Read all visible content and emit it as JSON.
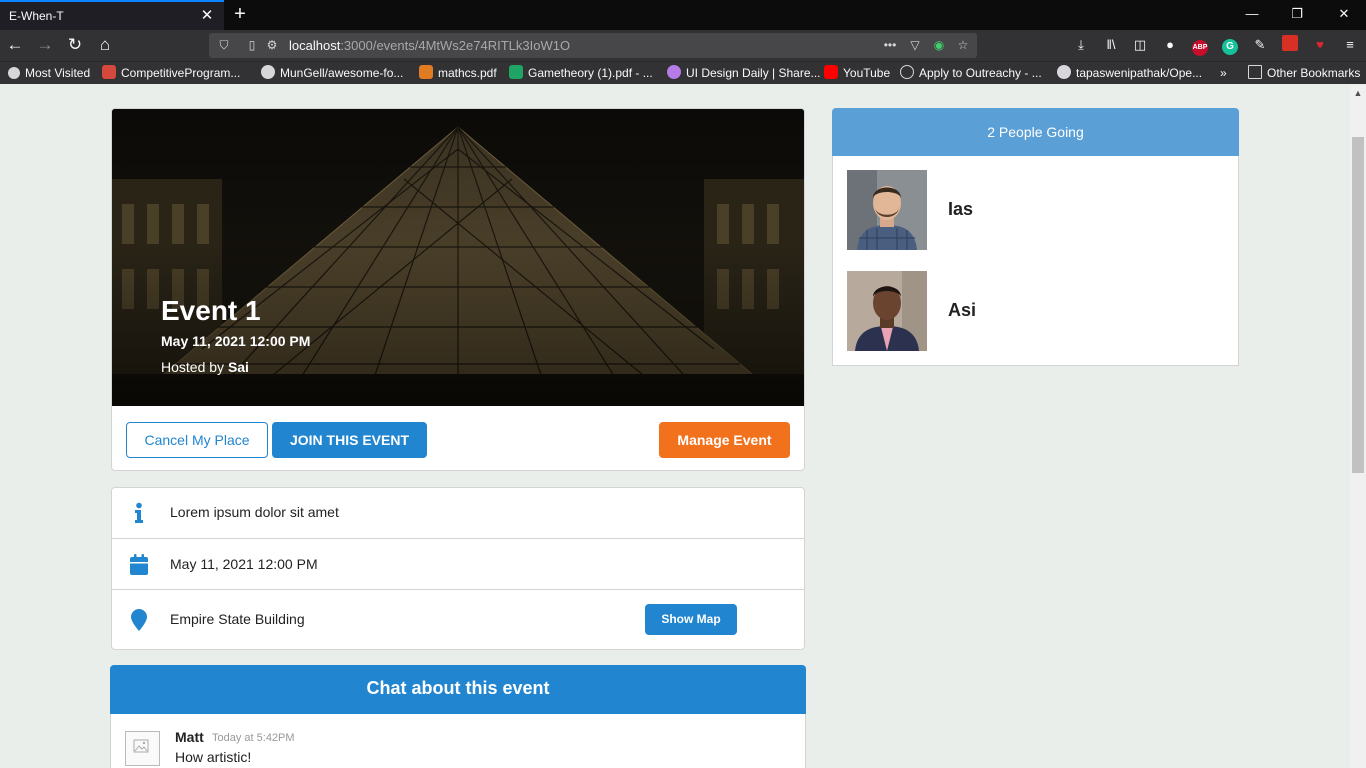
{
  "browser": {
    "tab_title": "E-When-T",
    "url_host": "localhost",
    "url_rest": ":3000/events/4MtWs2e74RITLk3IoW1O",
    "bookmarks": [
      "Most Visited",
      "CompetitiveProgram...",
      "MunGell/awesome-fo...",
      "mathcs.pdf",
      "Gametheory (1).pdf - ...",
      "UI Design Daily | Share...",
      "YouTube",
      "Apply to Outreachy - ...",
      "tapaswenipathak/Ope...",
      "Other Bookmarks"
    ]
  },
  "event": {
    "title": "Event 1",
    "date": "May 11, 2021 12:00 PM",
    "hosted_by_label": "Hosted by",
    "host": "Sai",
    "cancel_label": "Cancel My Place",
    "join_label": "JOIN THIS EVENT",
    "manage_label": "Manage Event"
  },
  "info": {
    "description": "Lorem ipsum dolor sit amet",
    "date": "May 11, 2021 12:00 PM",
    "venue": "Empire State Building",
    "show_map_label": "Show Map"
  },
  "chat": {
    "title": "Chat about this event",
    "messages": [
      {
        "author": "Matt",
        "time": "Today at 5:42PM",
        "text": "How artistic!"
      }
    ]
  },
  "attendees": {
    "header": "2 People Going",
    "people": [
      {
        "name": "Ias"
      },
      {
        "name": "Asi"
      }
    ]
  },
  "colors": {
    "primary": "#2185d0",
    "orange": "#f2711c",
    "sidebar_header": "#5a9fd6",
    "page_bg": "#eaeeea"
  }
}
